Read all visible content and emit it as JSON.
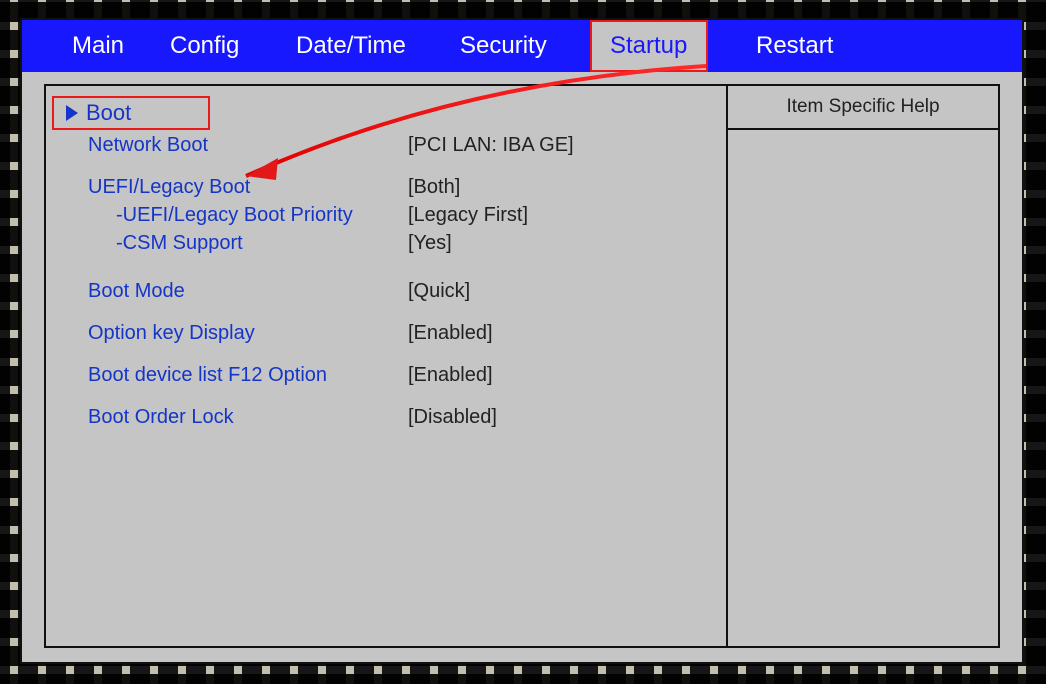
{
  "tabs": [
    "Main",
    "Config",
    "Date/Time",
    "Security",
    "Startup",
    "Restart"
  ],
  "activeTab": "Startup",
  "boot": {
    "title": "Boot"
  },
  "items": [
    {
      "label": "Network Boot",
      "value": "[PCI LAN: IBA GE]",
      "indent": 0
    },
    {
      "label": "UEFI/Legacy Boot",
      "value": "[Both]",
      "indent": 0,
      "gapBefore": "sm"
    },
    {
      "label": "-UEFI/Legacy Boot Priority",
      "value": "[Legacy First]",
      "indent": 1
    },
    {
      "label": "-CSM Support",
      "value": "[Yes]",
      "indent": 1
    },
    {
      "label": "Boot Mode",
      "value": "[Quick]",
      "indent": 0,
      "gapBefore": "md"
    },
    {
      "label": "Option key Display",
      "value": "[Enabled]",
      "indent": 0,
      "gapBefore": "sm"
    },
    {
      "label": "Boot device list F12 Option",
      "value": "[Enabled]",
      "indent": 0,
      "gapBefore": "sm"
    },
    {
      "label": "Boot Order Lock",
      "value": "[Disabled]",
      "indent": 0,
      "gapBefore": "sm"
    }
  ],
  "help": {
    "title": "Item Specific Help"
  }
}
